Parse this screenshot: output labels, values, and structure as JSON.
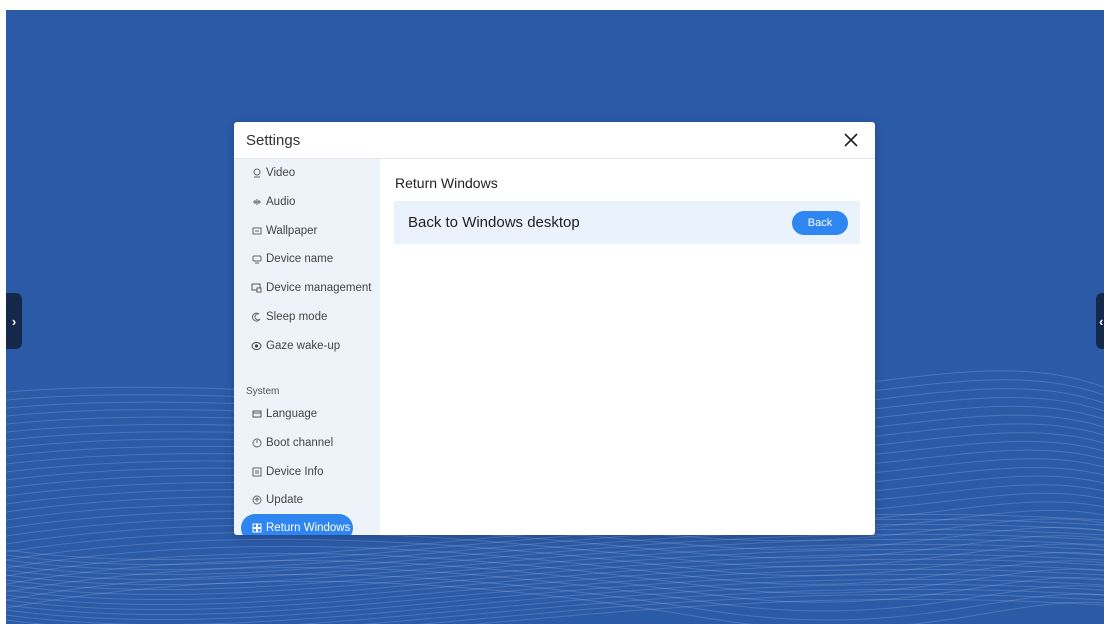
{
  "dialog": {
    "title": "Settings",
    "close_icon": "close-icon"
  },
  "sidebar": {
    "items": [
      {
        "label": "Video",
        "icon": "video-icon"
      },
      {
        "label": "Audio",
        "icon": "audio-icon"
      },
      {
        "label": "Wallpaper",
        "icon": "wallpaper-icon"
      },
      {
        "label": "Device name",
        "icon": "device-name-icon"
      },
      {
        "label": "Device management",
        "icon": "device-management-icon"
      },
      {
        "label": "Sleep mode",
        "icon": "sleep-mode-icon"
      },
      {
        "label": "Gaze wake-up",
        "icon": "eye-icon"
      }
    ],
    "section_label": "System",
    "system_items": [
      {
        "label": "Language",
        "icon": "language-icon"
      },
      {
        "label": "Boot channel",
        "icon": "boot-channel-icon"
      },
      {
        "label": "Device Info",
        "icon": "device-info-icon"
      },
      {
        "label": "Update",
        "icon": "update-icon"
      },
      {
        "label": "Return Windows",
        "icon": "windows-icon",
        "active": true
      }
    ]
  },
  "content": {
    "title": "Return Windows",
    "row_label": "Back to Windows desktop",
    "button_label": "Back"
  },
  "colors": {
    "desktop_bg": "#2b5aa7",
    "accent": "#2f86f0",
    "sidebar_bg": "#eef3fa",
    "row_bg": "#eaf2fb"
  }
}
